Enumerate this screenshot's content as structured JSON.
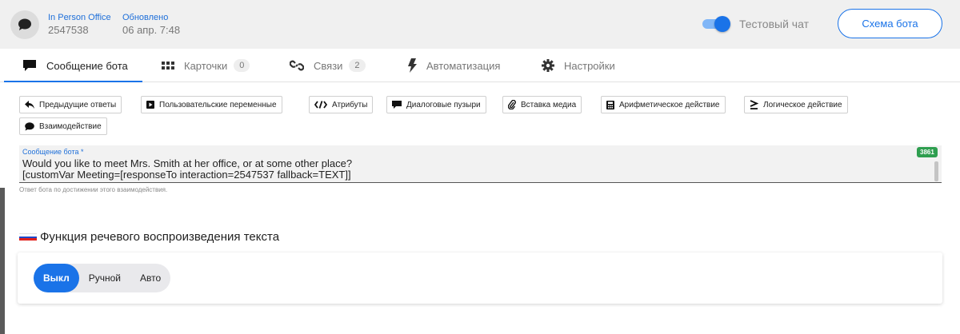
{
  "header": {
    "avatar_icon": "chat-bubble-icon",
    "channel_label": "In Person Office",
    "channel_id": "2547538",
    "updated_label": "Обновлено",
    "updated_value": "06 апр. 7:48",
    "test_chat_label": "Тестовый чат",
    "test_chat_enabled": true,
    "scheme_button": "Схема бота"
  },
  "tabs": [
    {
      "label": "Сообщение бота",
      "icon": "message-icon",
      "active": true
    },
    {
      "label": "Карточки",
      "icon": "grid-icon",
      "count": "0"
    },
    {
      "label": "Связи",
      "icon": "link-icon",
      "count": "2"
    },
    {
      "label": "Автоматизация",
      "icon": "lightning-icon"
    },
    {
      "label": "Настройки",
      "icon": "gear-icon"
    }
  ],
  "toolbar": [
    {
      "label": "Предыдущие ответы",
      "icon": "reply-icon"
    },
    {
      "label": "Пользовательские переменные",
      "icon": "play-box-icon"
    },
    {
      "label": "Атрибуты",
      "icon": "code-icon"
    },
    {
      "label": "Диалоговые пузыри",
      "icon": "bubble-icon"
    },
    {
      "label": "Вставка медиа",
      "icon": "paperclip-icon"
    },
    {
      "label": "Арифметическое действие",
      "icon": "calculator-icon"
    },
    {
      "label": "Логическое действие",
      "icon": "gte-icon"
    },
    {
      "label": "Взаимодействие",
      "icon": "chat-icon"
    }
  ],
  "message_field": {
    "label": "Сообщение бота *",
    "value": "Would you like to meet Mrs. Smith at her office, or at some other place?\n[customVar Meeting=[responseTo interaction=2547537 fallback=TEXT]]",
    "counter": "3861",
    "hint": "Ответ бота по достижении этого взаимодействия."
  },
  "tts": {
    "title": "Функция речевого воспроизведения текста",
    "flag_colors": [
      "#ffffff",
      "#1c48c9",
      "#e0201b"
    ],
    "options": [
      "Выкл",
      "Ручной",
      "Авто"
    ],
    "selected": "Выкл"
  },
  "colors": {
    "accent": "#1a73e8",
    "counter_bg": "#2e9e4f"
  }
}
